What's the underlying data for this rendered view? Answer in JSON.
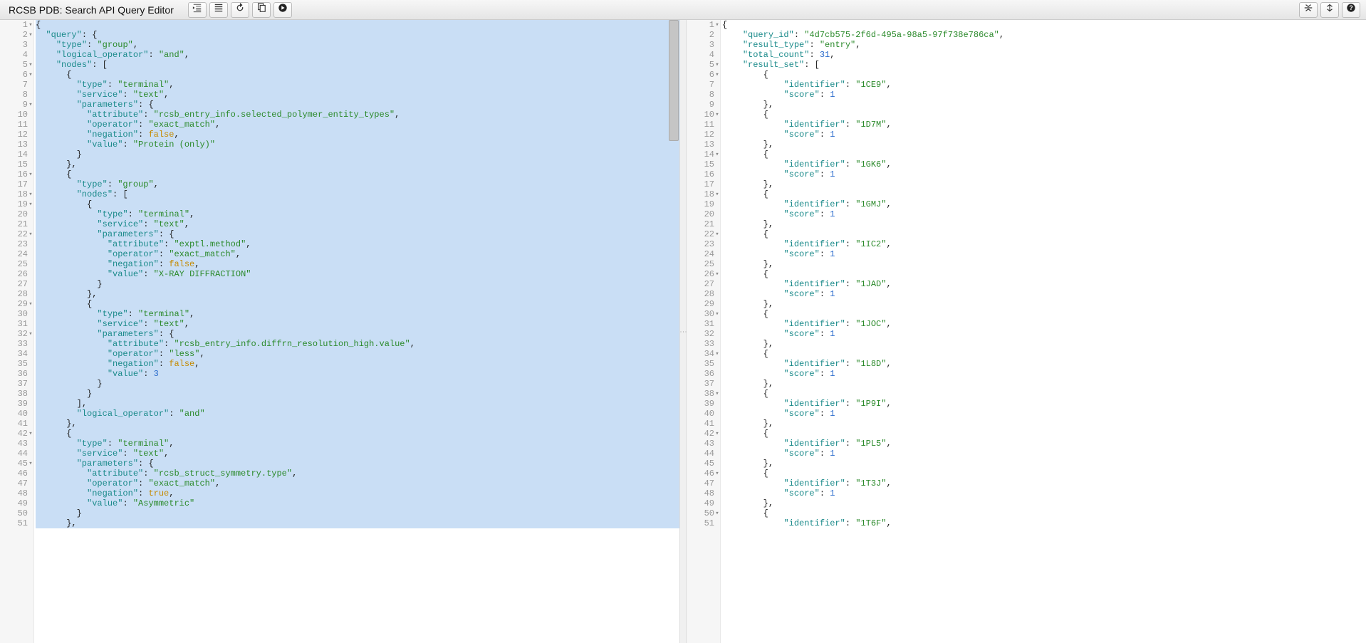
{
  "title": "RCSB PDB: Search API Query Editor",
  "toolbar_icons": {
    "indent_left": "indent-left-icon",
    "indent_full": "indent-full-icon",
    "reset": "reset-icon",
    "copy": "copy-icon",
    "run": "run-icon",
    "collapse_v": "collapse-vertical-icon",
    "expand_v": "expand-vertical-icon",
    "help": "help-icon"
  },
  "left_editor": {
    "foldable_lines": [
      1,
      2,
      5,
      6,
      9,
      16,
      18,
      19,
      22,
      29,
      32,
      42,
      45
    ],
    "lines": [
      "{",
      "  \"query\": {",
      "    \"type\": \"group\",",
      "    \"logical_operator\": \"and\",",
      "    \"nodes\": [",
      "      {",
      "        \"type\": \"terminal\",",
      "        \"service\": \"text\",",
      "        \"parameters\": {",
      "          \"attribute\": \"rcsb_entry_info.selected_polymer_entity_types\",",
      "          \"operator\": \"exact_match\",",
      "          \"negation\": false,",
      "          \"value\": \"Protein (only)\"",
      "        }",
      "      },",
      "      {",
      "        \"type\": \"group\",",
      "        \"nodes\": [",
      "          {",
      "            \"type\": \"terminal\",",
      "            \"service\": \"text\",",
      "            \"parameters\": {",
      "              \"attribute\": \"exptl.method\",",
      "              \"operator\": \"exact_match\",",
      "              \"negation\": false,",
      "              \"value\": \"X-RAY DIFFRACTION\"",
      "            }",
      "          },",
      "          {",
      "            \"type\": \"terminal\",",
      "            \"service\": \"text\",",
      "            \"parameters\": {",
      "              \"attribute\": \"rcsb_entry_info.diffrn_resolution_high.value\",",
      "              \"operator\": \"less\",",
      "              \"negation\": false,",
      "              \"value\": 3",
      "            }",
      "          }",
      "        ],",
      "        \"logical_operator\": \"and\"",
      "      },",
      "      {",
      "        \"type\": \"terminal\",",
      "        \"service\": \"text\",",
      "        \"parameters\": {",
      "          \"attribute\": \"rcsb_struct_symmetry.type\",",
      "          \"operator\": \"exact_match\",",
      "          \"negation\": true,",
      "          \"value\": \"Asymmetric\"",
      "        }",
      "      },"
    ]
  },
  "right_editor": {
    "foldable_lines": [
      1,
      5,
      6,
      10,
      14,
      18,
      22,
      26,
      30,
      34,
      38,
      42,
      46,
      50
    ],
    "lines": [
      "{",
      "    \"query_id\": \"4d7cb575-2f6d-495a-98a5-97f738e786ca\",",
      "    \"result_type\": \"entry\",",
      "    \"total_count\": 31,",
      "    \"result_set\": [",
      "        {",
      "            \"identifier\": \"1CE9\",",
      "            \"score\": 1",
      "        },",
      "        {",
      "            \"identifier\": \"1D7M\",",
      "            \"score\": 1",
      "        },",
      "        {",
      "            \"identifier\": \"1GK6\",",
      "            \"score\": 1",
      "        },",
      "        {",
      "            \"identifier\": \"1GMJ\",",
      "            \"score\": 1",
      "        },",
      "        {",
      "            \"identifier\": \"1IC2\",",
      "            \"score\": 1",
      "        },",
      "        {",
      "            \"identifier\": \"1JAD\",",
      "            \"score\": 1",
      "        },",
      "        {",
      "            \"identifier\": \"1JOC\",",
      "            \"score\": 1",
      "        },",
      "        {",
      "            \"identifier\": \"1L8D\",",
      "            \"score\": 1",
      "        },",
      "        {",
      "            \"identifier\": \"1P9I\",",
      "            \"score\": 1",
      "        },",
      "        {",
      "            \"identifier\": \"1PL5\",",
      "            \"score\": 1",
      "        },",
      "        {",
      "            \"identifier\": \"1T3J\",",
      "            \"score\": 1",
      "        },",
      "        {",
      "            \"identifier\": \"1T6F\","
    ]
  }
}
